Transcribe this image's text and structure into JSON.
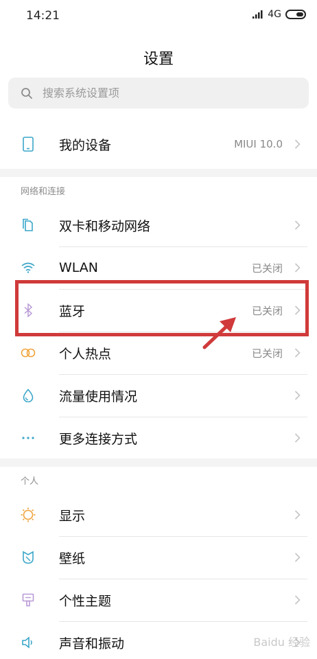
{
  "status": {
    "time": "14:21",
    "network": "4G"
  },
  "title": "设置",
  "search": {
    "placeholder": "搜索系统设置项"
  },
  "device": {
    "label": "我的设备",
    "value": "MIUI 10.0"
  },
  "sections": {
    "network": "网络和连接",
    "personal": "个人"
  },
  "network_items": [
    {
      "label": "双卡和移动网络",
      "value": ""
    },
    {
      "label": "WLAN",
      "value": "已关闭"
    },
    {
      "label": "蓝牙",
      "value": "已关闭"
    },
    {
      "label": "个人热点",
      "value": "已关闭"
    },
    {
      "label": "流量使用情况",
      "value": ""
    },
    {
      "label": "更多连接方式",
      "value": ""
    }
  ],
  "personal_items": [
    {
      "label": "显示",
      "value": ""
    },
    {
      "label": "壁纸",
      "value": ""
    },
    {
      "label": "个性主题",
      "value": ""
    },
    {
      "label": "声音和振动",
      "value": ""
    }
  ],
  "colors": {
    "accent_blue": "#3aa6c9",
    "highlight": "#d03a3a",
    "bluetooth": "#b99ad6",
    "hotspot": "#f0a33a"
  },
  "watermark": "Baidu 经验"
}
